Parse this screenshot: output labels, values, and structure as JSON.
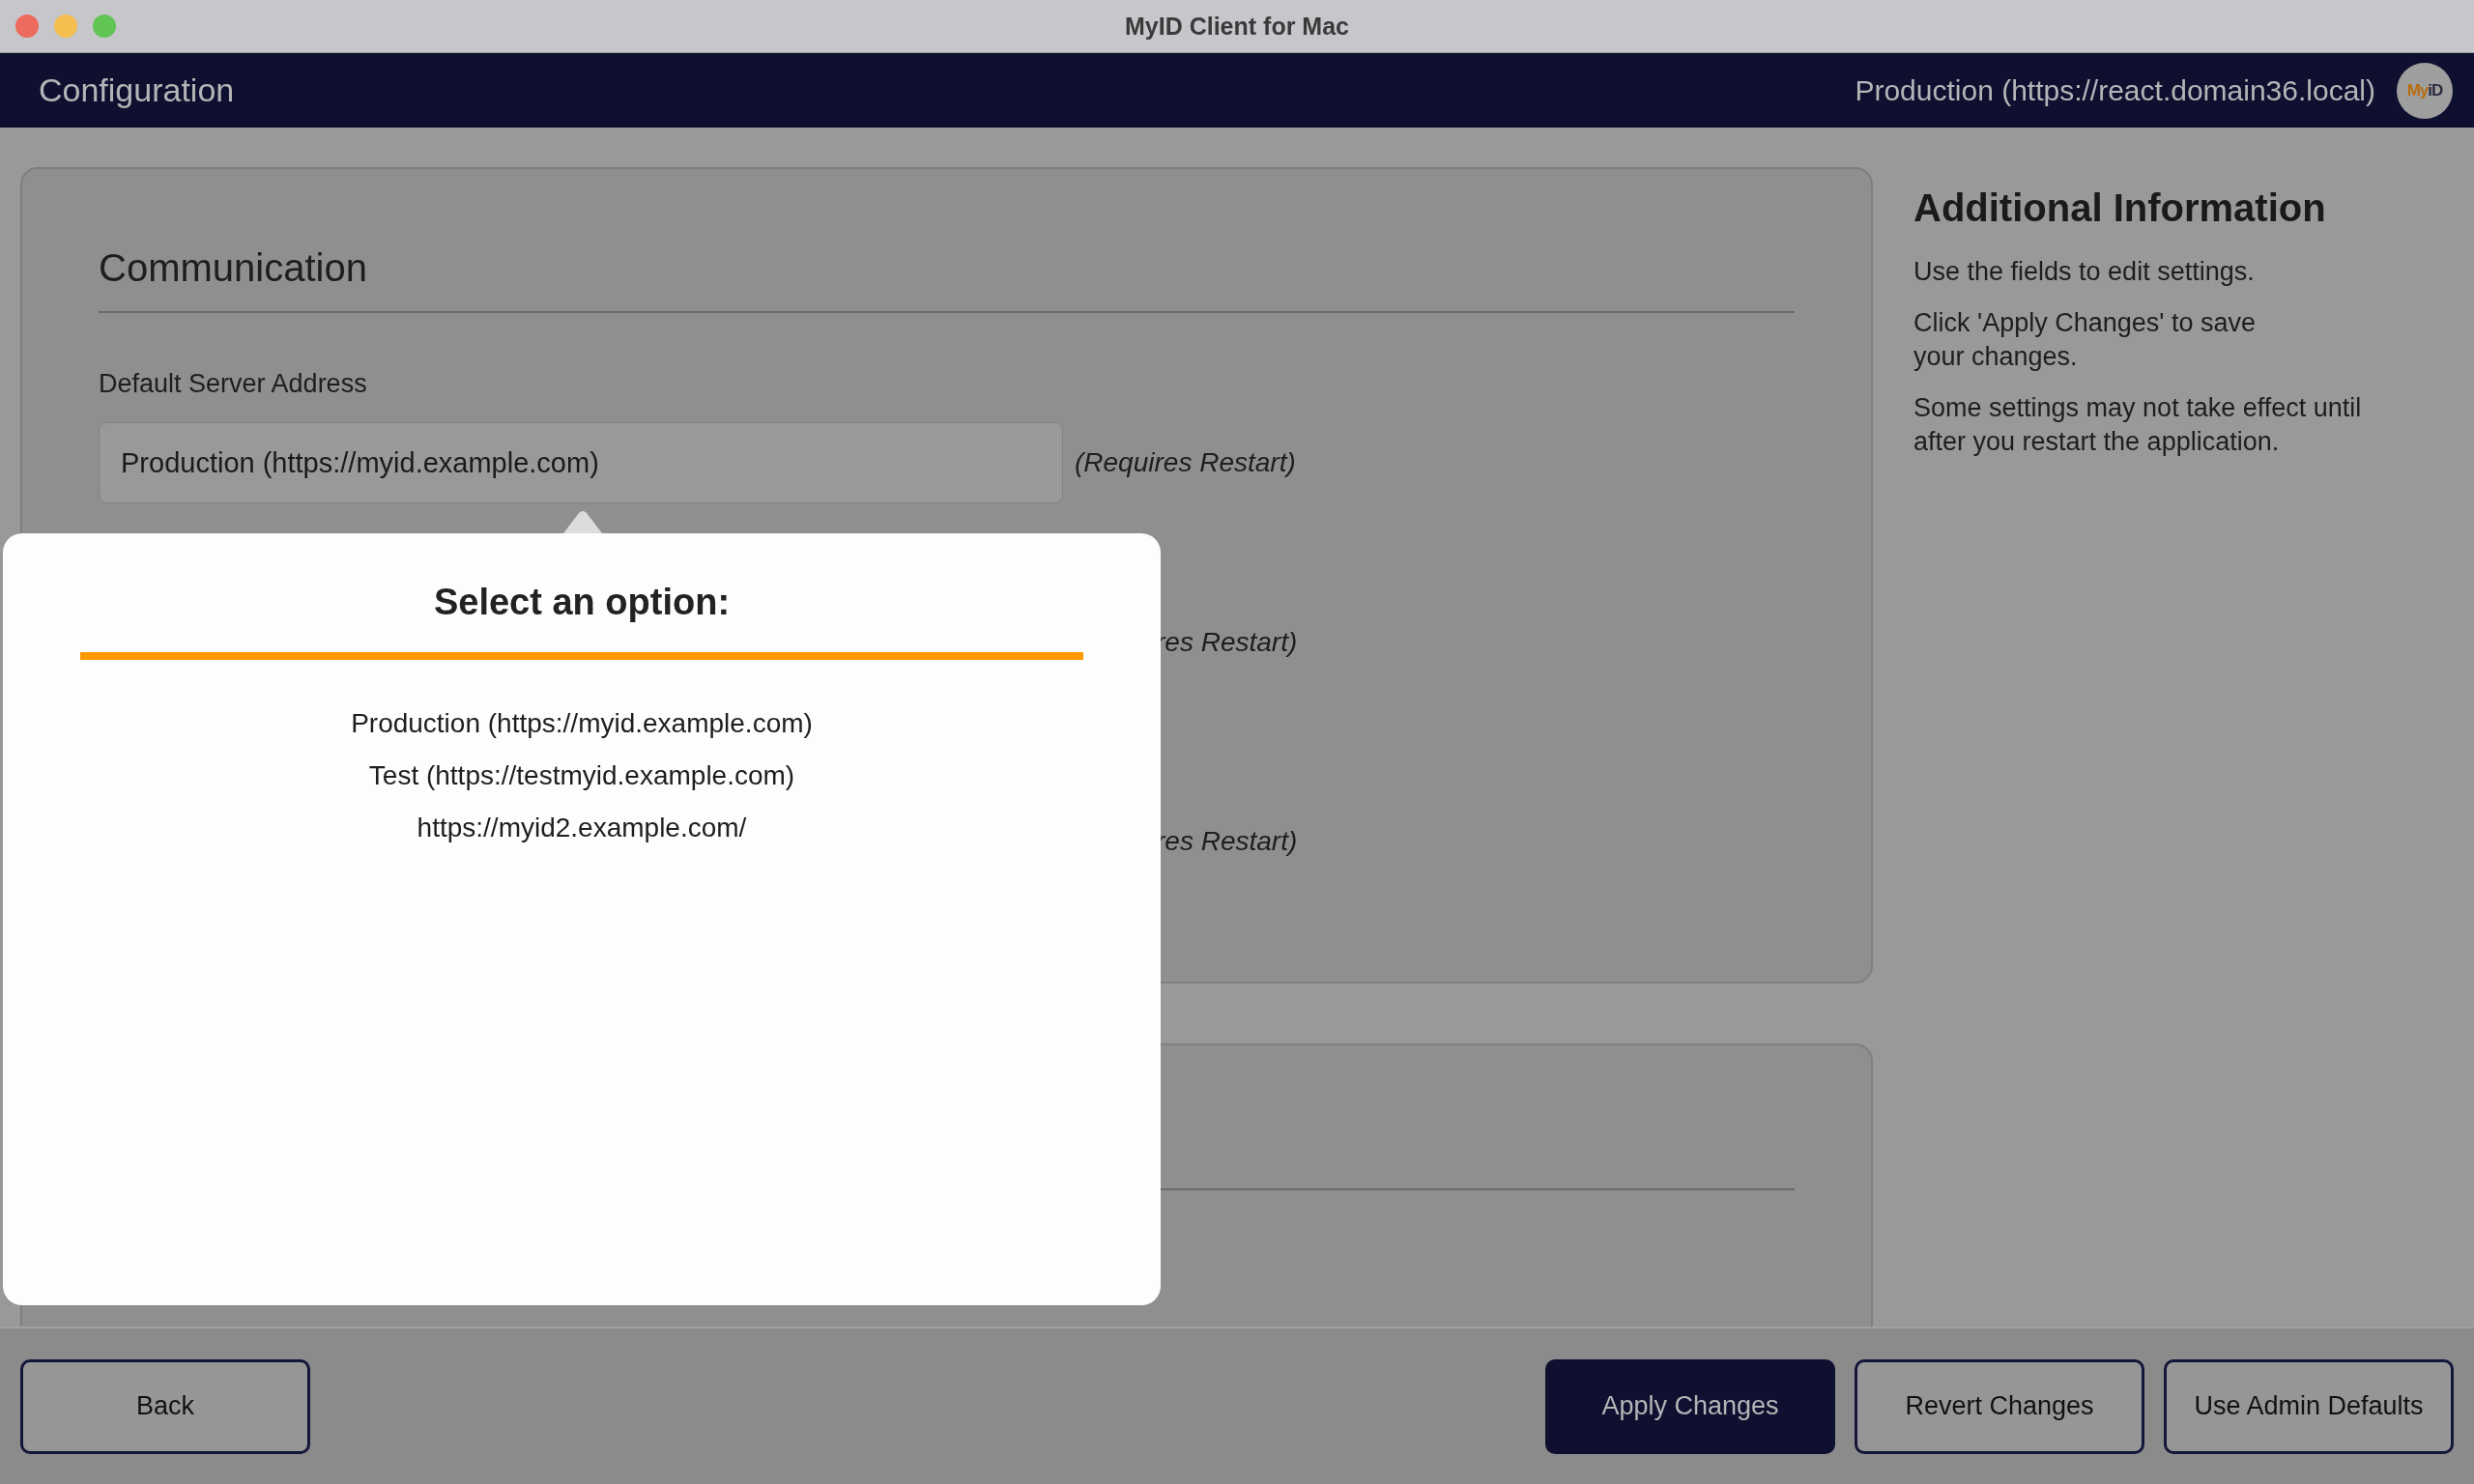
{
  "window": {
    "title": "MyID Client for Mac"
  },
  "header": {
    "title": "Configuration",
    "server": "Production (https://react.domain36.local)",
    "logo": {
      "text_a": "My",
      "text_b": "iD"
    }
  },
  "section": {
    "title": "Communication",
    "rows": [
      {
        "label": "Default Server Address",
        "value": "Production (https://myid.example.com)",
        "note": "(Requires Restart)"
      },
      {
        "note": "res Restart)"
      },
      {
        "note": "res Restart)"
      }
    ]
  },
  "info": {
    "title": "Additional Information",
    "paragraphs": [
      "Use the fields to edit settings.",
      "Click 'Apply Changes' to save\nyour changes.",
      "Some settings may not take effect until after you restart the application."
    ]
  },
  "popup": {
    "title": "Select an option:",
    "options": [
      "Production (https://myid.example.com)",
      "Test (https://testmyid.example.com)",
      "https://myid2.example.com/"
    ]
  },
  "footer": {
    "buttons": [
      {
        "label": "Back",
        "kind": "outline"
      },
      {
        "label": "Apply Changes",
        "kind": "primary"
      },
      {
        "label": "Revert Changes",
        "kind": "outline"
      },
      {
        "label": "Use Admin Defaults",
        "kind": "outline"
      }
    ]
  }
}
